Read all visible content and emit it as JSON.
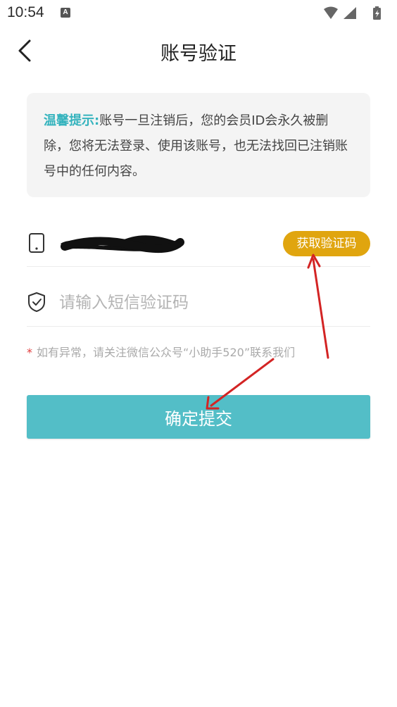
{
  "status_bar": {
    "time": "10:54",
    "notification_icon": "A"
  },
  "header": {
    "title": "账号验证",
    "back_icon": "chevron-left-icon"
  },
  "notice": {
    "label": "温馨提示:",
    "text": "账号一旦注销后，您的会员ID会永久被删除，您将无法登录、使用该账号，也无法找回已注销账号中的任何内容。"
  },
  "phone_row": {
    "icon": "smartphone-icon",
    "value": "",
    "get_code_label": "获取验证码"
  },
  "code_row": {
    "icon": "shield-check-icon",
    "placeholder": "请输入短信验证码",
    "value": ""
  },
  "tip": {
    "star": "*",
    "text": "如有异常，请关注微信公众号“小助手520”联系我们"
  },
  "submit": {
    "label": "确定提交"
  },
  "colors": {
    "accent_teal": "#53bec7",
    "notice_label": "#34b3bd",
    "get_code_button": "#e0a50f",
    "annotation_arrow": "#d32424"
  }
}
